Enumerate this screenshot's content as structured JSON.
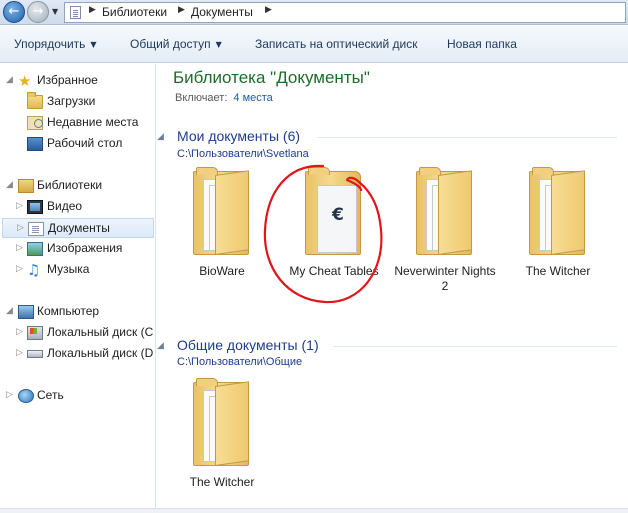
{
  "address": {
    "crumbs": [
      "Библиотеки",
      "Документы"
    ]
  },
  "toolbar": {
    "organize": "Упорядочить",
    "share": "Общий доступ",
    "burn": "Записать на оптический диск",
    "new_folder": "Новая папка"
  },
  "navpane": {
    "favorites": "Избранное",
    "downloads": "Загрузки",
    "recent": "Недавние места",
    "desktop": "Рабочий стол",
    "libraries": "Библиотеки",
    "video": "Видео",
    "documents": "Документы",
    "images": "Изображения",
    "music": "Музыка",
    "computer": "Компьютер",
    "disk_c": "Локальный диск (C",
    "disk_d": "Локальный диск (D",
    "network": "Сеть"
  },
  "content": {
    "title": "Библиотека \"Документы\"",
    "includes_label": "Включает:",
    "includes_link": "4 места",
    "groups": [
      {
        "header": "Мои документы (6)",
        "path": "C:\\Пользователи\\Svetlana",
        "items": [
          "BioWare",
          "My Cheat Tables",
          "Neverwinter Nights 2",
          "The Witcher"
        ]
      },
      {
        "header": "Общие документы (1)",
        "path": "C:\\Пользователи\\Общие",
        "items": [
          "The Witcher"
        ]
      }
    ]
  },
  "annotation_color": "#e0161b",
  "icons": {
    "back": "back-arrow-icon",
    "forward": "forward-arrow-icon",
    "cheat_engine": "cheat-engine-icon"
  }
}
